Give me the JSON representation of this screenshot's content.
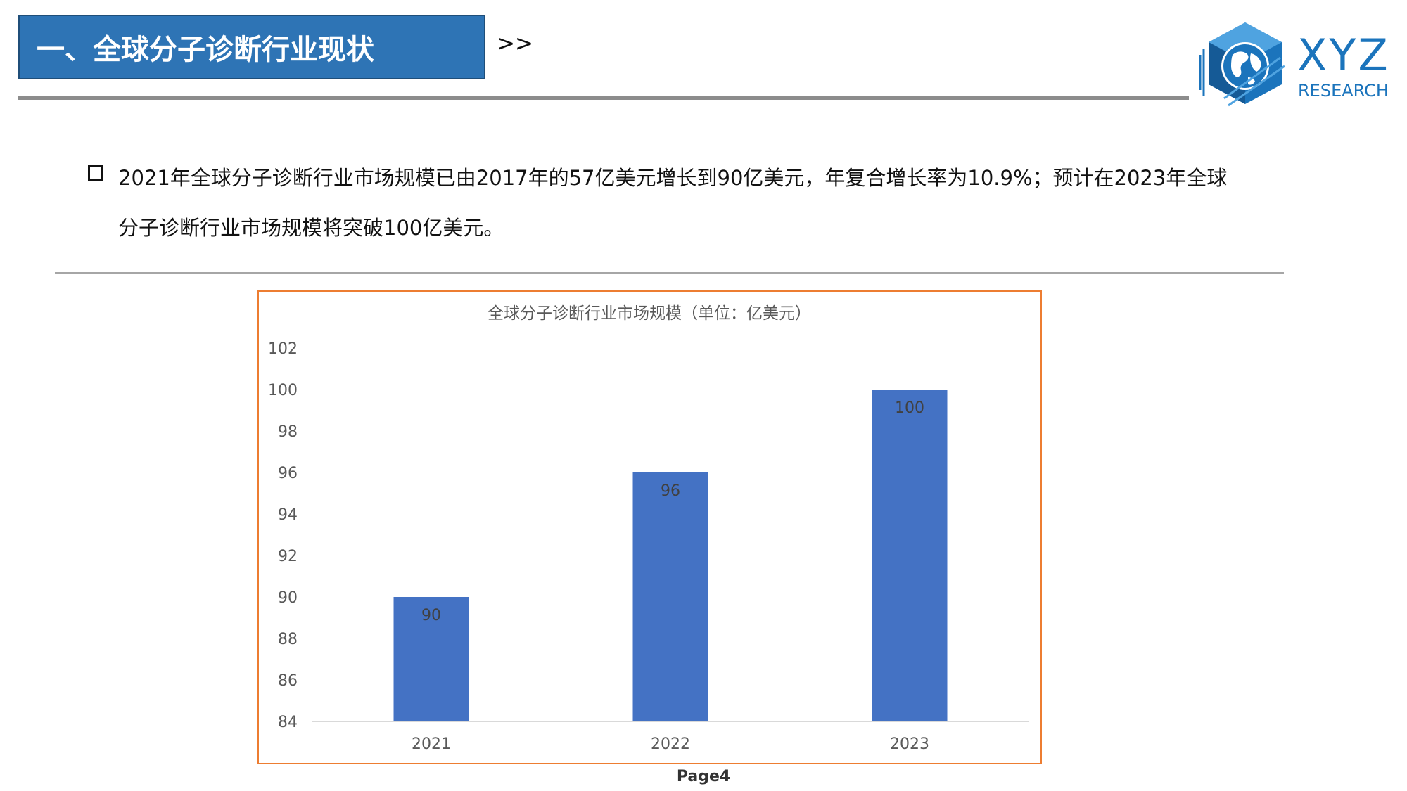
{
  "header": {
    "title": "一、全球分子诊断行业现状",
    "arrows": ">>"
  },
  "logo": {
    "primary": "XYZ",
    "secondary": "RESEARCH"
  },
  "content": {
    "bullet": "2021年全球分子诊断行业市场规模已由2017年的57亿美元增长到90亿美元，年复合增长率为10.9%；预计在2023年全球分子诊断行业市场规模将突破100亿美元。"
  },
  "chart_data": {
    "type": "bar",
    "title": "全球分子诊断行业市场规模（单位：亿美元）",
    "categories": [
      "2021",
      "2022",
      "2023"
    ],
    "values": [
      90,
      96,
      100
    ],
    "data_labels": [
      "90",
      "96",
      "100"
    ],
    "y_ticks": [
      "84",
      "86",
      "88",
      "90",
      "92",
      "94",
      "96",
      "98",
      "100",
      "102"
    ],
    "ylim": [
      84,
      102
    ],
    "xlabel": "",
    "ylabel": "",
    "grid": false,
    "legend": "none",
    "bar_color": "#4472c4"
  },
  "footer": {
    "page": "Page4"
  },
  "colors": {
    "title_bg": "#2e74b5",
    "accent_border": "#ed7d31",
    "logo_blue": "#1b74bc"
  }
}
